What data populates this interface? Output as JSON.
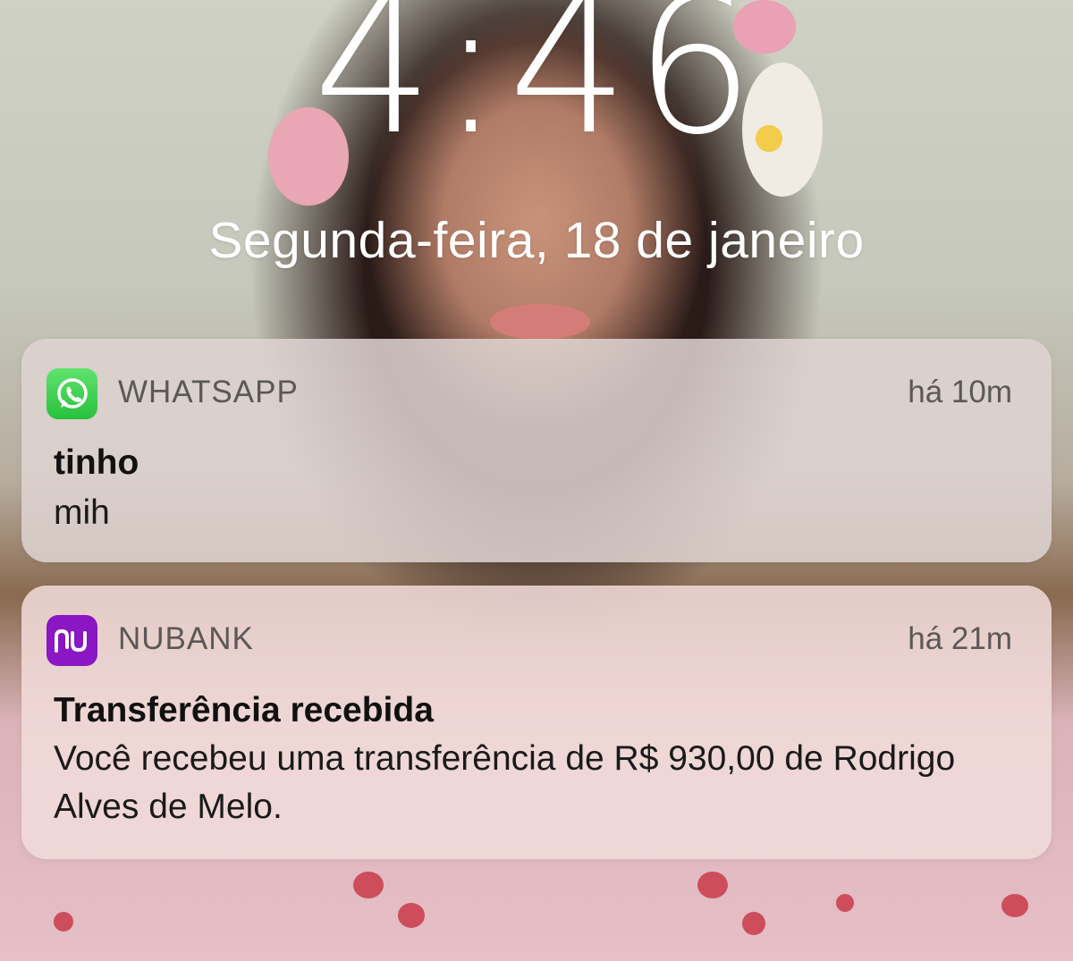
{
  "lockscreen": {
    "time": "4:46",
    "date": "Segunda-feira, 18 de janeiro"
  },
  "notifications": [
    {
      "app": "WHATSAPP",
      "icon": "whatsapp-icon",
      "icon_color": "#4cd964",
      "time_ago": "há 10m",
      "title": "tinho",
      "body": "mih"
    },
    {
      "app": "NUBANK",
      "icon": "nubank-icon",
      "icon_color": "#8a16c4",
      "time_ago": "há 21m",
      "title": "Transferência recebida",
      "body": "Você recebeu uma transferência de R$ 930,00 de Rodrigo Alves de Melo."
    }
  ]
}
